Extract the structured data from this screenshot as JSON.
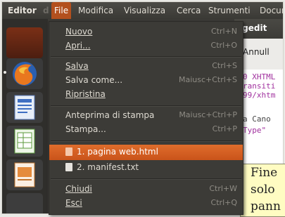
{
  "panel": {
    "app_title": "Editor",
    "menubar": [
      "File",
      "Modifica",
      "Visualizza",
      "Cerca",
      "Strumenti",
      "Docum"
    ]
  },
  "file_menu": {
    "items": [
      {
        "label": "Nuovo",
        "shortcut": "Ctrl+N"
      },
      {
        "label": "Apri...",
        "shortcut": "Ctrl+O"
      },
      {
        "label": "Salva",
        "shortcut": "Ctrl+S"
      },
      {
        "label": "Salva come...",
        "shortcut": "Maiusc+Ctrl+S"
      },
      {
        "label": "Ripristina",
        "shortcut": ""
      },
      {
        "label": "Anteprima di stampa",
        "shortcut": "Maiusc+Ctrl+P"
      },
      {
        "label": "Stampa...",
        "shortcut": "Ctrl+P"
      },
      {
        "label": "1. pagina web.html",
        "shortcut": ""
      },
      {
        "label": "2. manifest.txt",
        "shortcut": ""
      },
      {
        "label": "Chiudi",
        "shortcut": "Ctrl+W"
      },
      {
        "label": "Esci",
        "shortcut": "Ctrl+Q"
      }
    ]
  },
  "editor": {
    "title": "- gedit",
    "toolbar_label": "Annull",
    "code_lines": [
      "0 XHTML",
      "ransiti",
      "99/xhtm",
      "a Cano",
      "Type\""
    ]
  },
  "tooltip": {
    "lines": [
      "Fine",
      "solo",
      "pann"
    ]
  },
  "colors": {
    "accent": "#dd6b2a",
    "menu_bg": "#3c3b37"
  }
}
